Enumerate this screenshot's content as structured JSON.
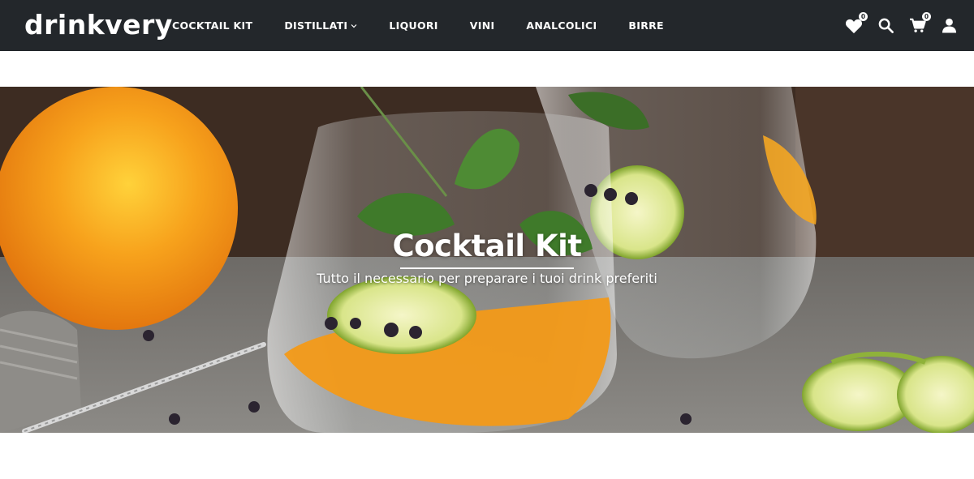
{
  "header": {
    "logo": "drinkvery",
    "nav": [
      {
        "label": "COCKTAIL KIT",
        "has_dropdown": false
      },
      {
        "label": "DISTILLATI",
        "has_dropdown": true
      },
      {
        "label": "LIQUORI",
        "has_dropdown": false
      },
      {
        "label": "VINI",
        "has_dropdown": false
      },
      {
        "label": "ANALCOLICI",
        "has_dropdown": false
      },
      {
        "label": "BIRRE",
        "has_dropdown": false
      }
    ],
    "icons": {
      "wishlist": {
        "icon": "heart-icon",
        "count": "0"
      },
      "search": {
        "icon": "search-icon"
      },
      "cart": {
        "icon": "cart-icon",
        "count": "0"
      },
      "account": {
        "icon": "user-icon"
      }
    },
    "background": "#23272b"
  },
  "hero": {
    "title": "Cocktail Kit",
    "subtitle": "Tutto il necessario per preparare i tuoi drink preferiti",
    "image": "gin-tonic-orange-lime-photo"
  }
}
